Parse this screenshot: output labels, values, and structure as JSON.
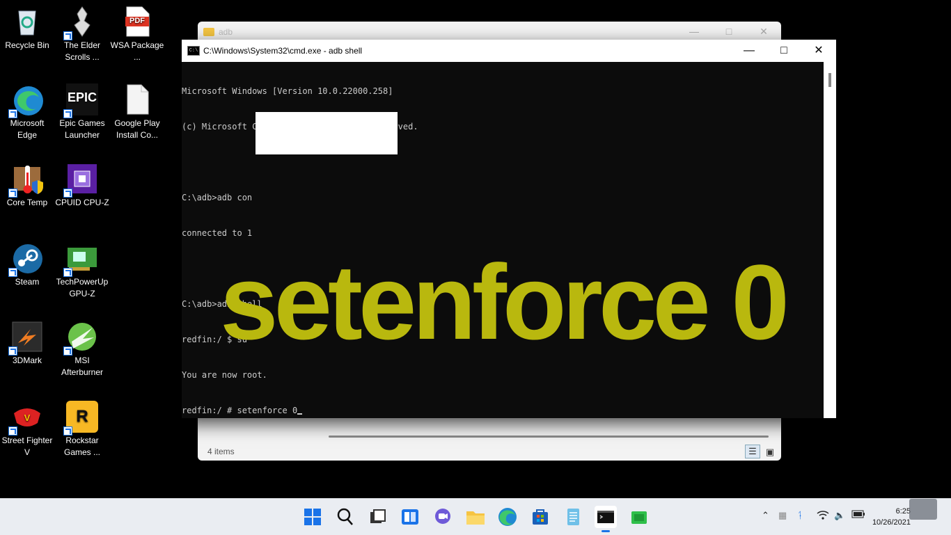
{
  "desktop": {
    "icons": [
      {
        "label": "Recycle Bin",
        "icon": "recycle-bin-icon"
      },
      {
        "label": "The Elder Scrolls ...",
        "icon": "elder-scrolls-icon"
      },
      {
        "label": "WSA Package ...",
        "icon": "pdf-icon",
        "badge": "PDF"
      },
      {
        "label": "Microsoft Edge",
        "icon": "edge-icon"
      },
      {
        "label": "Epic Games Launcher",
        "icon": "epic-games-icon",
        "badge": "EPIC"
      },
      {
        "label": "Google Play Install Co...",
        "icon": "document-icon"
      },
      {
        "label": "Core Temp",
        "icon": "core-temp-icon"
      },
      {
        "label": "CPUID CPU-Z",
        "icon": "cpuz-icon"
      },
      {
        "label": "Steam",
        "icon": "steam-icon"
      },
      {
        "label": "TechPowerUp GPU-Z",
        "icon": "gpuz-icon"
      },
      {
        "label": "3DMark",
        "icon": "3dmark-icon"
      },
      {
        "label": "MSI Afterburner",
        "icon": "afterburner-icon"
      },
      {
        "label": "Street Fighter V",
        "icon": "street-fighter-icon"
      },
      {
        "label": "Rockstar Games ...",
        "icon": "rockstar-icon",
        "badge": "R"
      }
    ]
  },
  "explorer": {
    "title": "adb",
    "item_count": "4 items"
  },
  "cmd": {
    "title": "C:\\Windows\\System32\\cmd.exe - adb  shell",
    "lines": [
      "Microsoft Windows [Version 10.0.22000.258]",
      "(c) Microsoft Corporation. All rights reserved.",
      "",
      "C:\\adb>adb con",
      "connected to 1",
      "",
      "C:\\adb>adb shell",
      "redfin:/ $ su",
      "You are now root.",
      "redfin:/ # setenforce 0"
    ],
    "overlay_text": "setenforce 0",
    "overlay_color": "#b9b80e"
  },
  "taskbar": {
    "apps": [
      "start-icon",
      "search-icon",
      "task-view-icon",
      "widgets-icon",
      "chat-icon",
      "file-explorer-icon",
      "edge-icon",
      "store-icon",
      "notepad-icon",
      "terminal-icon",
      "android-icon"
    ],
    "time": "6:25",
    "date": "10/26/2021"
  }
}
